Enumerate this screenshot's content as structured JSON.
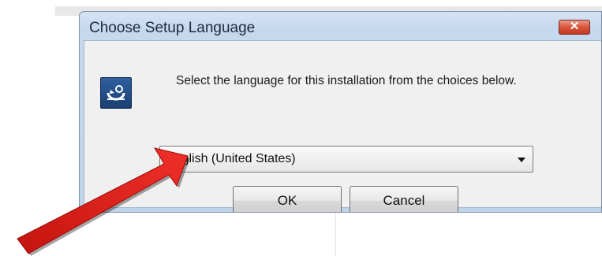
{
  "dialog": {
    "title": "Choose Setup Language",
    "close_label": "✕",
    "prompt": "Select the language for this installation from the choices below.",
    "language_select": {
      "selected": "English (United States)"
    },
    "ok_label": "OK",
    "cancel_label": "Cancel"
  },
  "annotation": {
    "arrow_color": "#e8231c",
    "icon": "red-pointer-arrow-icon"
  },
  "icons": {
    "app": "setup-installer-icon",
    "dropdown": "chevron-down-icon",
    "close": "close-icon"
  }
}
